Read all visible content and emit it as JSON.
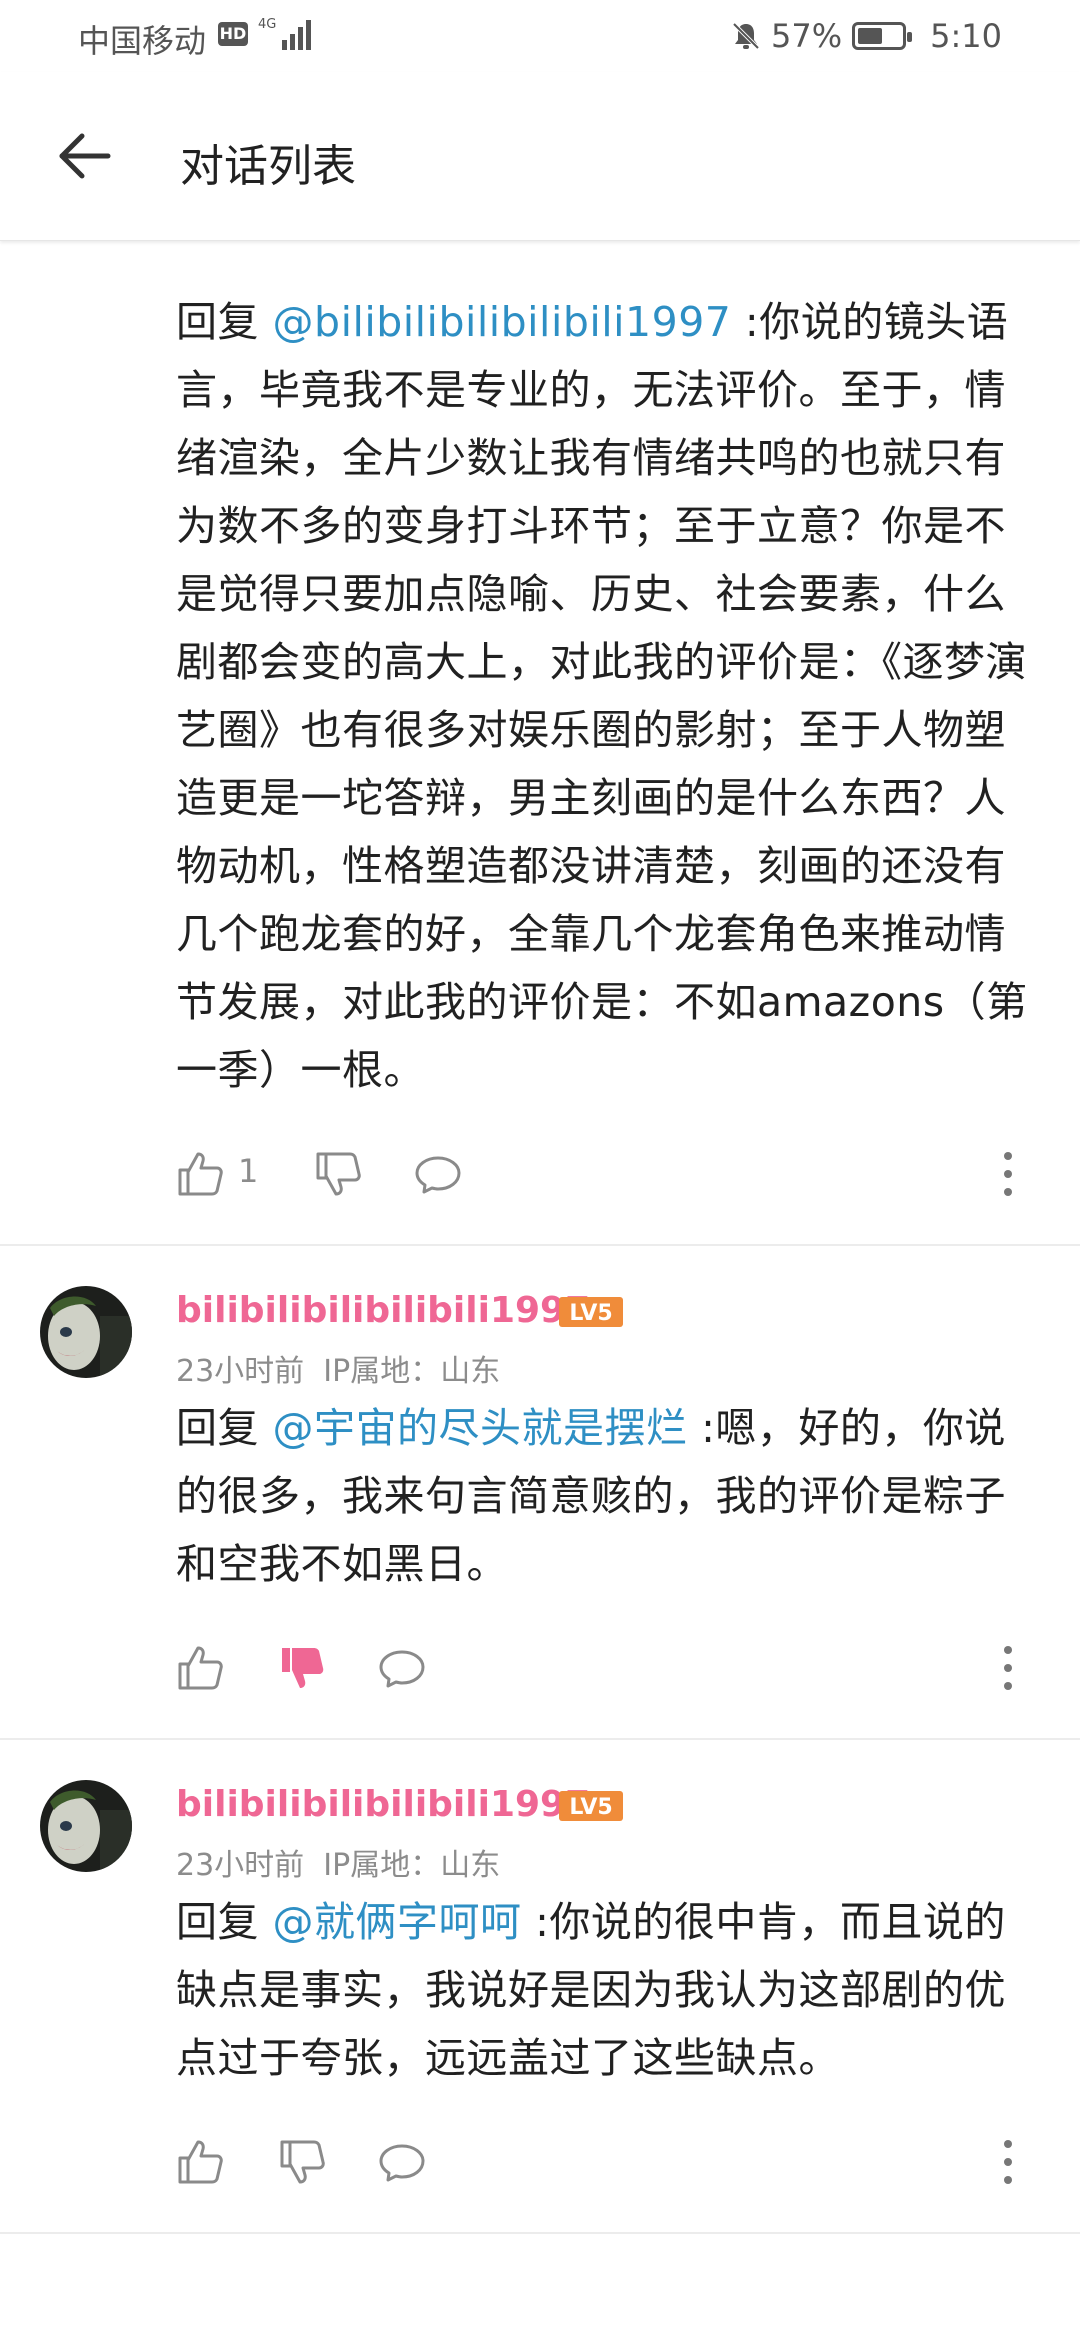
{
  "status_bar": {
    "carrier": "中国移动",
    "hd": "HD",
    "battery_percent": "57%",
    "battery_level": 0.57,
    "time": "5:10"
  },
  "app_bar": {
    "back_icon": "arrow-left-icon",
    "title": "对话列表"
  },
  "colors": {
    "username": "#ef6794",
    "mention": "#2e8fc4",
    "badge": "#f08c3a",
    "dislike_active": "#ef6794"
  },
  "comments": [
    {
      "reply_prefix": "回复 ",
      "mention": "@bilibilibilibilibili1997",
      "text": " :你说的镜头语言，毕竟我不是专业的，无法评价。至于，情绪渲染，全片少数让我有情绪共鸣的也就只有为数不多的变身打斗环节；至于立意？你是不是觉得只要加点隐喻、历史、社会要素，什么剧都会变的高大上，对此我的评价是：《逐梦演艺圈》也有很多对娱乐圈的影射；至于人物塑造更是一坨答辩，男主刻画的是什么东西？人物动机，性格塑造都没讲清楚，刻画的还没有几个跑龙套的好，全靠几个龙套角色来推动情节发展，对此我的评价是：不如amazons（第一季）一根。",
      "like_count": "1"
    },
    {
      "username": "bilibilibilibilibili1997",
      "level": "LV5",
      "time": "23小时前",
      "ip": "IP属地：山东",
      "reply_prefix": "回复 ",
      "mention": "@宇宙的尽头就是摆烂",
      "text": " :嗯，好的，你说的很多，我来句言简意赅的，我的评价是粽子和空我不如黑日。",
      "disliked": true
    },
    {
      "username": "bilibilibilibilibili1997",
      "level": "LV5",
      "time": "23小时前",
      "ip": "IP属地：山东",
      "reply_prefix": "回复 ",
      "mention": "@就俩字呵呵",
      "text": " :你说的很中肯，而且说的缺点是事实，我说好是因为我认为这部剧的优点过于夸张，远远盖过了这些缺点。"
    }
  ]
}
